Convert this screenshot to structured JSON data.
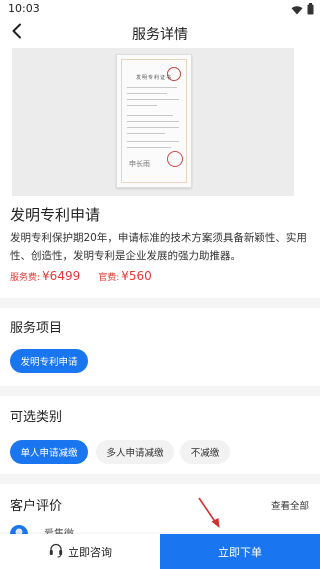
{
  "status_bar": {
    "time": "10:03",
    "icons": [
      "wifi-icon",
      "battery-icon"
    ]
  },
  "nav": {
    "title": "服务详情",
    "back_icon": "back-arrow-icon"
  },
  "hero": {
    "certificate_title": "发明专利证书",
    "signature": "申长雨"
  },
  "service": {
    "name": "发明专利申请",
    "description": "发明专利保护期20年，申请标准的技术方案须具备新颖性、实用性、创造性，发明专利是企业发展的强力助推器。",
    "service_fee_label": "服务费:",
    "service_fee_value": "¥6499",
    "official_fee_label": "官费:",
    "official_fee_value": "¥560"
  },
  "service_items": {
    "title": "服务项目",
    "items": [
      "发明专利申请"
    ]
  },
  "categories": {
    "title": "可选类别",
    "options": [
      "单人申请减缴",
      "多人申请减缴",
      "不减缴"
    ],
    "selected": "单人申请减缴"
  },
  "reviews": {
    "title": "客户评价",
    "view_all_label": "查看全部",
    "reviewer_name": "爱集微"
  },
  "bottom_bar": {
    "consult_label": "立即咨询",
    "consult_icon": "headset-icon",
    "order_label": "立即下单"
  },
  "colors": {
    "accent": "#1976f0",
    "price": "#e53935",
    "annotation_arrow": "#d32f2f"
  }
}
